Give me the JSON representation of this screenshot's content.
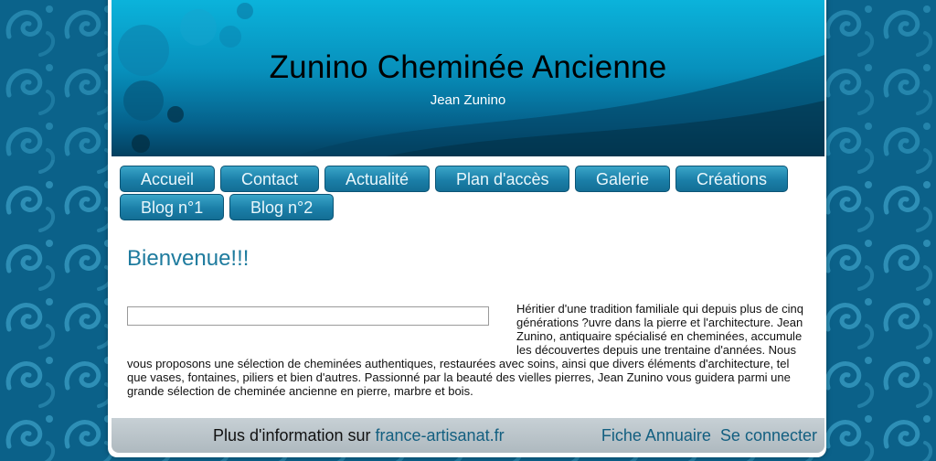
{
  "colors": {
    "background": "#0a5f82",
    "header_accent": "#0bb3db",
    "nav_button": "#1b7fa8",
    "heading": "#1e7b9e",
    "footer": "#b9c4ca",
    "link": "#135f80"
  },
  "header": {
    "title": "Zunino Cheminée Ancienne",
    "subtitle": "Jean Zunino"
  },
  "nav": {
    "items": [
      {
        "label": "Accueil"
      },
      {
        "label": "Contact"
      },
      {
        "label": "Actualité"
      },
      {
        "label": "Plan d'accès"
      },
      {
        "label": "Galerie"
      },
      {
        "label": "Créations"
      },
      {
        "label": "Blog n°1"
      },
      {
        "label": "Blog n°2"
      }
    ]
  },
  "main": {
    "heading": "Bienvenue!!!",
    "body": "Héritier d'une tradition familiale qui depuis plus de cinq générations ?uvre dans la pierre et l'architecture. Jean Zunino, antiquaire spécialisé en cheminées, accumule les découvertes depuis une trentaine d'années. Nous vous proposons une sélection de cheminées authentiques, restaurées avec soins, ainsi que divers éléments d'architecture, tel que vases, fontaines, piliers et bien d'autres. Passionné par la beauté des vielles pierres, Jean Zunino vous guidera parmi une grande sélection de cheminée ancienne en pierre, marbre et bois."
  },
  "footer": {
    "info_prefix": "Plus d'information sur ",
    "info_link": "france-artisanat.fr",
    "directory_link": "Fiche Annuaire",
    "login_link": "Se connecter"
  }
}
